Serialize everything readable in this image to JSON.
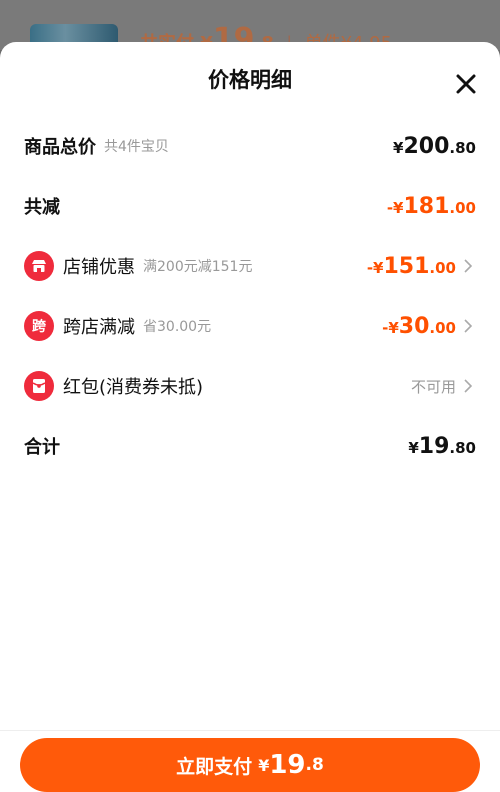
{
  "background": {
    "summary_prefix": "共实付",
    "summary_currency": "¥",
    "summary_int": "19",
    "summary_dec": ".8",
    "summary_unit_label": "单件",
    "summary_unit_price": "¥4.95"
  },
  "sheet": {
    "title": "价格明细",
    "close_icon": "close-icon"
  },
  "rows": {
    "total": {
      "label": "商品总价",
      "sub": "共4件宝贝",
      "currency": "¥",
      "int": "200",
      "dec": ".80"
    },
    "reduce": {
      "label": "共减",
      "sign": "-",
      "currency": "¥",
      "int": "181",
      "dec": ".00"
    },
    "store": {
      "label": "店铺优惠",
      "sub": "满200元减151元",
      "sign": "-",
      "currency": "¥",
      "int": "151",
      "dec": ".00",
      "icon": "store-icon"
    },
    "cross": {
      "badge": "跨",
      "label": "跨店满减",
      "sub": "省30.00元",
      "sign": "-",
      "currency": "¥",
      "int": "30",
      "dec": ".00"
    },
    "redpacket": {
      "label": "红包(消费券未抵)",
      "status": "不可用",
      "icon": "red-packet-icon"
    },
    "sum": {
      "label": "合计",
      "currency": "¥",
      "int": "19",
      "dec": ".80"
    }
  },
  "footer": {
    "pay_label": "立即支付",
    "currency": "¥",
    "int": "19",
    "dec": ".8"
  },
  "colors": {
    "accent": "#ff5000",
    "badge": "#ef2b3c",
    "button": "#ff5a0a"
  }
}
